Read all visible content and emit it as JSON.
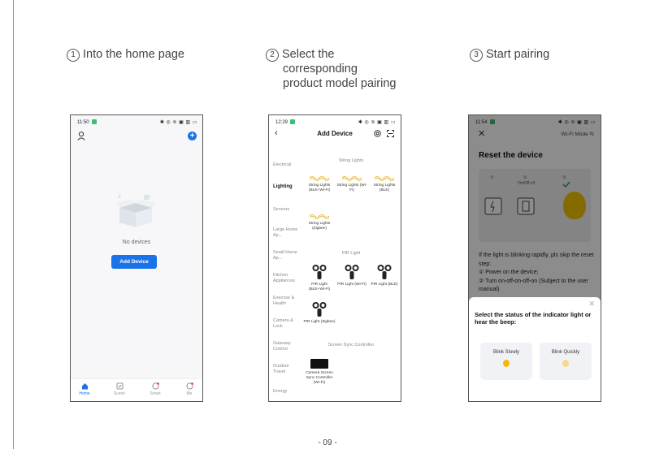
{
  "steps": [
    {
      "num": "1",
      "lines": [
        "Into the home page"
      ]
    },
    {
      "num": "2",
      "lines": [
        "Select the",
        "corresponding",
        "product model pairing"
      ]
    },
    {
      "num": "3",
      "lines": [
        "Start pairing"
      ]
    }
  ],
  "phone1": {
    "time": "11:50",
    "status_right": "✱ ◎ ≋ ▣ ▥ ▭",
    "empty_text": "No devices",
    "add_button": "Add Device",
    "tabs": [
      "Home",
      "Scene",
      "Smart",
      "Me"
    ],
    "accent": "#1a73e8"
  },
  "phone2": {
    "time": "12:29",
    "status_right": "✱ ◎ ≋ ▣ ▥ ▭",
    "title": "Add Device",
    "categories": [
      "Electrical",
      "Lighting",
      "Sensors",
      "Large Home Ap...",
      "Small Home Ap...",
      "Kitchen Appliances",
      "Exercise & Health",
      "Camera & Lock",
      "Gateway Control",
      "Outdoor Travel",
      "Energy"
    ],
    "selected_category": "Lighting",
    "sections": {
      "string_lights": "String Lights",
      "pir_light": "PIR Light",
      "screen_sync": "Screen Sync Controller"
    },
    "string_products": [
      "String Lights (BLE+Wi-Fi)",
      "String Lights (Wi-Fi)",
      "String Lights (BLE)",
      "String Lights (Zigbee)"
    ],
    "pir_products": [
      "PIR Light (BLE+Wi-Fi)",
      "PIR Light (Wi-Fi)",
      "PIR Light (BLE)",
      "PIR Light (Zigbee)"
    ],
    "sync_products": [
      "Camera Screen Sync Controller (Wi-Fi)"
    ]
  },
  "phone3": {
    "time": "11:54",
    "status_right": "✱ ◎ ≋ ▣ ▥ ▭",
    "mode": "Wi-Fi Mode ⇆",
    "title": "Reset the device",
    "illu_labels": [
      "①",
      "②",
      "③",
      "On/Off x3"
    ],
    "instructions": [
      "If the light is blinking rapidly, pls skip the reset step:",
      "① Power on the device;",
      "② Turn on-off-on-off-on (Subject to the user manual)"
    ],
    "sheet_title": "Select the status of the indicator light or hear the beep:",
    "options": [
      "Blink Slowly",
      "Blink Quickly"
    ]
  },
  "footer": "- 09 -"
}
